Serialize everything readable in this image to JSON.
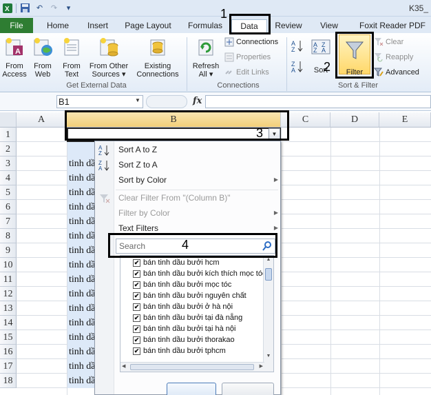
{
  "window": {
    "title": "K35_"
  },
  "qat": {
    "save": "💾",
    "undo": "↶",
    "redo": "↷",
    "customize": "▾"
  },
  "tabs": [
    {
      "label": "File"
    },
    {
      "label": "Home"
    },
    {
      "label": "Insert"
    },
    {
      "label": "Page Layout"
    },
    {
      "label": "Formulas"
    },
    {
      "label": "Data"
    },
    {
      "label": "Review"
    },
    {
      "label": "View"
    },
    {
      "label": "Foxit Reader PDF"
    }
  ],
  "ribbon": {
    "get_external": {
      "label": "Get External Data",
      "from_access": "From\nAccess",
      "from_web": "From\nWeb",
      "from_text": "From\nText",
      "from_other": "From Other\nSources ▾",
      "existing": "Existing\nConnections"
    },
    "connections": {
      "label": "Connections",
      "refresh": "Refresh\nAll ▾",
      "connections": "Connections",
      "properties": "Properties",
      "edit_links": "Edit Links"
    },
    "sort_filter": {
      "label": "Sort & Filter",
      "sort": "Sort",
      "filter": "Filter",
      "clear": "Clear",
      "reapply": "Reapply",
      "advanced": "Advanced"
    }
  },
  "formula_bar": {
    "name_box": "B1",
    "fx": "fx",
    "value": ""
  },
  "columns": [
    "A",
    "B",
    "C",
    "D",
    "E"
  ],
  "rows": [
    "1",
    "2",
    "3",
    "4",
    "5",
    "6",
    "7",
    "8",
    "9",
    "10",
    "11",
    "12",
    "13",
    "14",
    "15",
    "16",
    "17",
    "18"
  ],
  "column_b_cells": [
    "",
    "",
    "tinh dầ",
    "tinh dầ",
    "tinh dầ",
    "tinh dầ",
    "tinh dầ",
    "tinh dầ",
    "tinh dầ",
    "tinh dầ",
    "tinh dầ",
    "tinh dầ",
    "tinh dầ",
    "tinh dầ",
    "tinh dầ",
    "tinh dầ",
    "tinh dầ",
    "tinh dầ"
  ],
  "filter_menu": {
    "sort_az": "Sort A to Z",
    "sort_za": "Sort Z to A",
    "sort_color": "Sort by Color",
    "clear_filter": "Clear Filter From \"(Column B)\"",
    "filter_color": "Filter by Color",
    "text_filters": "Text Filters",
    "search_placeholder": "Search",
    "values": [
      "bán tinh dầu bưởi hcm",
      "bán tinh dầu bưởi kích thích mọc tóc",
      "bán tinh dầu bưởi mọc tóc",
      "bán tinh dầu bưởi nguyên chất",
      "bán tinh dầu bưởi ở hà nội",
      "bán tinh dầu bưởi tại đà nẵng",
      "bán tinh dầu bưởi tại hà nội",
      "bán tinh dầu bưởi thorakao",
      "bán tinh dầu bưởi tphcm"
    ]
  },
  "annotations": {
    "n1": "1",
    "n2": "2",
    "n3": "3",
    "n4": "4"
  }
}
